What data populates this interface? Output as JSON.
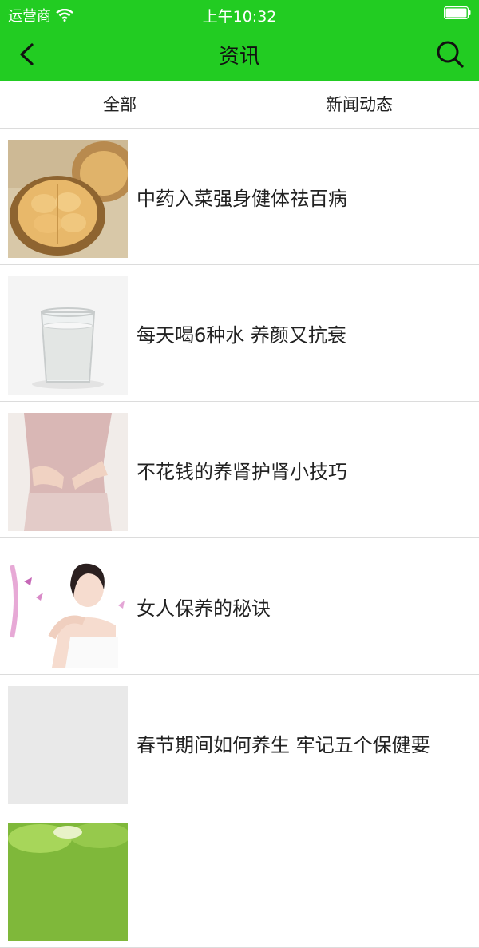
{
  "status_bar": {
    "carrier": "运营商",
    "time": "上午10:32"
  },
  "nav": {
    "title": "资讯",
    "back_icon": "chevron-left-icon",
    "search_icon": "search-icon"
  },
  "tabs": [
    {
      "label": "全部"
    },
    {
      "label": "新闻动态"
    }
  ],
  "articles": [
    {
      "title": "中药入菜强身健体祛百病",
      "image": "walnut"
    },
    {
      "title": "每天喝6种水 养颜又抗衰",
      "image": "glass-of-water"
    },
    {
      "title": "不花钱的养肾护肾小技巧",
      "image": "lower-back"
    },
    {
      "title": "女人保养的秘诀",
      "image": "woman-portrait"
    },
    {
      "title": "春节期间如何养生 牢记五个保健要",
      "image": "placeholder"
    },
    {
      "title": "",
      "image": "green-leaves"
    }
  ],
  "colors": {
    "accent": "#22cc22",
    "divider": "#dcdcdc"
  }
}
